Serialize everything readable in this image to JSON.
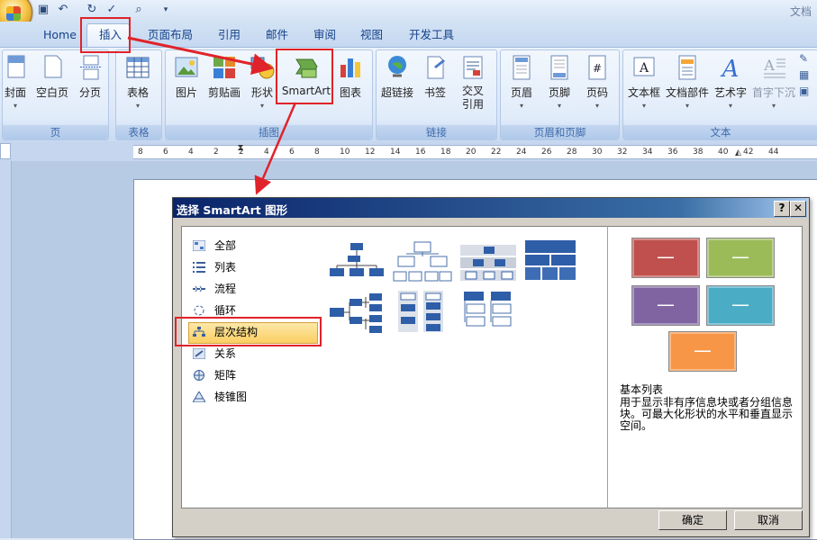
{
  "window": {
    "title": "文档"
  },
  "tabs": [
    "Home",
    "插入",
    "页面布局",
    "引用",
    "邮件",
    "审阅",
    "视图",
    "开发工具"
  ],
  "ribbon": {
    "groups": [
      {
        "label": "页",
        "buttons": [
          "封面",
          "空白页",
          "分页"
        ]
      },
      {
        "label": "表格",
        "buttons": [
          "表格"
        ]
      },
      {
        "label": "插图",
        "buttons": [
          "图片",
          "剪贴画",
          "形状",
          "SmartArt",
          "图表"
        ]
      },
      {
        "label": "链接",
        "buttons": [
          "超链接",
          "书签",
          "交叉\n引用"
        ]
      },
      {
        "label": "页眉和页脚",
        "buttons": [
          "页眉",
          "页脚",
          "页码"
        ]
      },
      {
        "label": "文本",
        "buttons": [
          "文本框",
          "文档部件",
          "艺术字",
          "首字下沉"
        ]
      }
    ]
  },
  "ruler": {
    "ticks": [
      "8",
      "6",
      "4",
      "2",
      "2",
      "4",
      "6",
      "8",
      "10",
      "12",
      "14",
      "16",
      "18",
      "20",
      "22",
      "24",
      "26",
      "28",
      "30",
      "32",
      "34",
      "36",
      "38",
      "40",
      "42",
      "44"
    ]
  },
  "dialog": {
    "title": "选择 SmartArt 图形",
    "help": "?",
    "close": "✕",
    "categories": [
      "全部",
      "列表",
      "流程",
      "循环",
      "层次结构",
      "关系",
      "矩阵",
      "棱锥图"
    ],
    "selected_category": "层次结构",
    "preview": {
      "swatch_label": "—",
      "name": "基本列表",
      "description": "用于显示非有序信息块或者分组信息块。可最大化形状的水平和垂直显示空间。",
      "colors": [
        "#c0504d",
        "#9bbb59",
        "#8064a2",
        "#4bacc6",
        "#f79646"
      ]
    },
    "ok": "确定",
    "cancel": "取消"
  },
  "colors": {
    "accent": "#15428b",
    "highlight": "#e0232a"
  }
}
